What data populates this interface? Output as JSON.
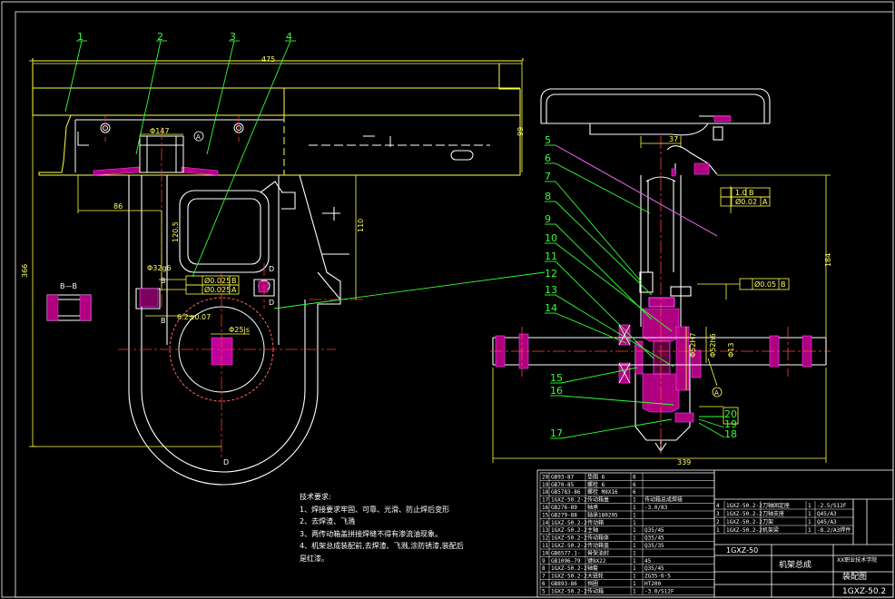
{
  "callouts_left": [
    "1",
    "2",
    "3",
    "4"
  ],
  "callouts_right": [
    "5",
    "6",
    "7",
    "8",
    "9",
    "10",
    "11",
    "12",
    "13",
    "14",
    "15",
    "16",
    "17",
    "18",
    "19",
    "20"
  ],
  "dimensions": {
    "top_width": "475",
    "height_total": "366",
    "bore_top": "Φ147",
    "offset_left": "86",
    "offset_vertical": "120.5",
    "height_right": "99",
    "bracket_offset": "110",
    "right_top": "37",
    "right_height": "184",
    "right_width": "339",
    "shaft_dia": "Φ32g6",
    "tol_1": "Ø0.025",
    "tol_1_ref": "B",
    "tol_2": "Ø0.025",
    "tol_2_ref": "A",
    "distance_tol": "6.2±0.07",
    "hub_dia": "Φ25js",
    "perp_val": "1.0",
    "perp_ref": "B",
    "conc_val": "Ø0.02",
    "conc_ref": "A",
    "runout_val": "Ø0.05",
    "runout_ref": "B",
    "datum_a": "A",
    "datum_d": "D",
    "section_label": "B—B",
    "section_mark": "B",
    "bearing_1": "Φ52H7",
    "bearing_2": "Φ52h6",
    "bearing_3": "Φ13"
  },
  "notes": {
    "title": "技术要求:",
    "items": [
      "1、焊接要求牢固、可靠、光滑、防止焊后变形",
      "2、去焊渣、飞溅",
      "3、两传动箱盖拼接焊缝不得有渗流油现象。",
      "4、机架总成装配前,去焊渣、飞溅,涂防锈漆,装配后",
      "是红漆。"
    ]
  },
  "bom_left": [
    [
      "20",
      "GB93-87",
      "垫圈 6",
      "6",
      ""
    ],
    [
      "19",
      "GB70-85",
      "螺栓 6",
      "6",
      ""
    ],
    [
      "18",
      "GB5783-86",
      "螺栓 M8X16",
      "6",
      ""
    ],
    [
      "17",
      "1GXZ-50.2-2",
      "传动箱盖",
      "1",
      "传动箱总成焊接"
    ],
    [
      "16",
      "GB276-89",
      "轴承",
      "1",
      "-3.0/83"
    ],
    [
      "15",
      "GB279-88",
      "轴承180205",
      "1",
      ""
    ],
    [
      "14",
      "1GXZ-50.2-2",
      "传动箱",
      "1",
      ""
    ],
    [
      "13",
      "1GXZ-50.2-2",
      "主轴",
      "1",
      "Q35/45"
    ],
    [
      "12",
      "1GXZ-50.2-2",
      "传动箱体",
      "1",
      "Q35/45"
    ],
    [
      "11",
      "1GXZ-50.2-2",
      "传动箱盖",
      "1",
      "Q35/35"
    ],
    [
      "10",
      "GB6577.1-",
      "骨架油封",
      "1",
      ""
    ],
    [
      "9",
      "GB1096-79",
      "键8X22",
      "1",
      "45"
    ],
    [
      "8",
      "1GXZ-50.2-2",
      "轴套",
      "1",
      "Q35/45"
    ],
    [
      "7",
      "1GXZ-50.2-2",
      "大链轮",
      "1",
      "ZG35-6-5"
    ],
    [
      "6",
      "GB893-86",
      "挡圈",
      "1",
      "HT200"
    ],
    [
      "5",
      "1GXZ-50.2-2",
      "传动箱",
      "1",
      "-3.0/S12F"
    ]
  ],
  "bom_right": [
    [
      "4",
      "1GXZ-50.2-2",
      "刀轴固定座",
      "1",
      "-2.5/S12F"
    ],
    [
      "3",
      "1GXZ-50.2-2",
      "刀轴支座",
      "1",
      "Q45/A3"
    ],
    [
      "2",
      "1GXZ-50.2-2",
      "刀架",
      "1",
      "Q45/A3"
    ],
    [
      "1",
      "1GXZ-50.2-2",
      "机架梁",
      "1",
      "-8.2/A3焊件"
    ]
  ],
  "title_block": {
    "code": "1GXZ-50",
    "name": "机架总成",
    "drawing_type": "装配图",
    "drawing_no": "1GXZ-50.2",
    "school": "XX职业技术学院"
  }
}
